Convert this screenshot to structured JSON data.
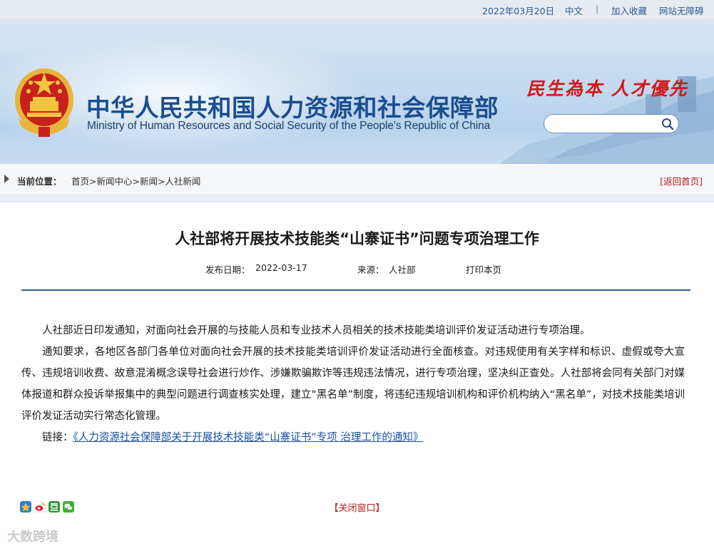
{
  "topbar": {
    "date": "2022年03月20日",
    "lang": "中文",
    "separator": "|",
    "bookmark": "加入收藏",
    "accessibility": "网站无障碍"
  },
  "banner": {
    "cn_title": "中华人民共和国人力资源和社会保障部",
    "en_title": "Ministry of Human Resources and Social Security of the People's Republic of China",
    "slogan": "民生為本 人才優先",
    "search_placeholder": ""
  },
  "breadcrumb": {
    "label": "当前位置：",
    "path": "首页>新闻中心>新闻>人社新闻",
    "back": "[返回首页]"
  },
  "article": {
    "title": "人社部将开展技术技能类“山寨证书”问题专项治理工作",
    "publish_label": "发布日期：",
    "publish_date": "2022-03-17",
    "source_label": "来源：",
    "source": "人社部",
    "print": "打印本页",
    "paragraphs": [
      "人社部近日印发通知，对面向社会开展的与技能人员和专业技术人员相关的技术技能类培训评价发证活动进行专项治理。",
      "通知要求，各地区各部门各单位对面向社会开展的技术技能类培训评价发证活动进行全面核查。对违规使用有关字样和标识、虚假或夸大宣传、违规培训收费、故意混淆概念误导社会进行炒作、涉嫌欺骗欺诈等违规违法情况，进行专项治理，坚决纠正查处。人社部将会同有关部门对媒体报道和群众投诉举报集中的典型问题进行调查核实处理，建立“黑名单”制度，将违纪违规培训机构和评价机构纳入“黑名单”，对技术技能类培训评价发证活动实行常态化管理。"
    ],
    "link_label": "链接：",
    "link_text": "《人力资源社会保障部关于开展技术技能类“山寨证书”专项 治理工作的通知》",
    "close": "【关闭窗口】"
  },
  "watermark": "大数跨境",
  "colors": {
    "brand_blue": "#1b4d8f",
    "slogan_red": "#d4161b",
    "rule": "#2c5d8a"
  }
}
